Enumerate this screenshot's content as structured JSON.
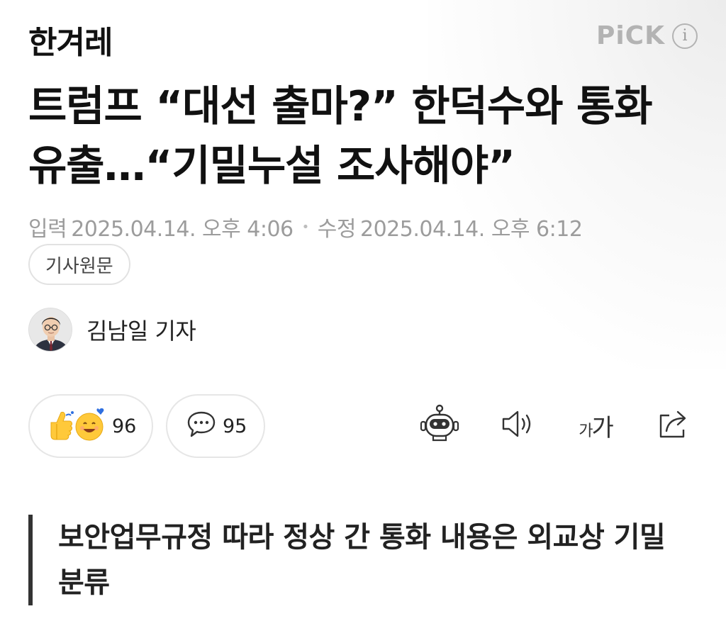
{
  "header": {
    "logo": "한겨레",
    "pick_label": "PiCK",
    "info_glyph": "i"
  },
  "article": {
    "title": "트럼프 “대선 출마?” 한덕수와 통화 유출…“기밀누설 조사해야”",
    "input_label": "입력",
    "input_date": "2025.04.14. 오후 4:06",
    "modified_label": "수정",
    "modified_date": "2025.04.14. 오후 6:12",
    "source_button": "기사원문",
    "reporter": "김남일 기자",
    "subhead": "보안업무규정 따라 정상 간 통화 내용은 외교상 기밀 분류"
  },
  "actions": {
    "reaction_count": "96",
    "comment_count": "95",
    "font_size_small": "가",
    "font_size_large": "가"
  },
  "icons": {
    "reaction": "reaction-emoji-icon",
    "comment": "comment-bubble-icon",
    "summary_bot": "robot-icon",
    "tts": "speaker-icon",
    "font_size": "font-size-icon",
    "share": "share-icon",
    "info": "info-icon"
  },
  "colors": {
    "pick": "#b3b3b3",
    "date_text": "#9c9c9c",
    "emoji_yellow": "#ffc93a",
    "emoji_blue": "#2f6fe0"
  }
}
